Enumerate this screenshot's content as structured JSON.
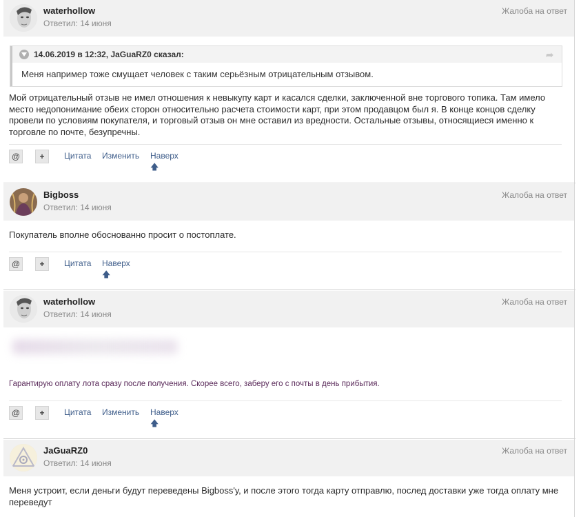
{
  "posts": [
    {
      "author": "waterhollow",
      "answered": "Ответил: 14 июня",
      "report": "Жалоба на ответ",
      "avatar": "face-avatar",
      "quote": {
        "header": "14.06.2019 в 12:32, JaGuaRZ0 сказал:",
        "text": "Меня например тоже смущает человек с таким серьёзным отрицательным отзывом."
      },
      "content": "Мой отрицательный отзыв не имел отношения к невыкупу карт и касался сделки, заключенной вне торгового топика. Там имело место недопонимание обеих сторон относительно расчета стоимости карт, при этом продавцом был я. В конце концов сделку провели по условиям покупателя, и торговый отзыв он мне оставил из вредности. Остальные отзывы, относящиеся именно к торговле по почте, безупречны.",
      "actions": {
        "mention": "@",
        "plus": "+",
        "quote": "Цитата",
        "edit": "Изменить",
        "up": "Наверх"
      }
    },
    {
      "author": "Bigboss",
      "answered": "Ответил: 14 июня",
      "report": "Жалоба на ответ",
      "avatar": "portrait-avatar",
      "content": "Покупатель вполне обоснованно просит о постоплате.",
      "actions": {
        "mention": "@",
        "plus": "+",
        "quote": "Цитата",
        "up": "Наверх"
      }
    },
    {
      "author": "waterhollow",
      "answered": "Ответил: 14 июня",
      "report": "Жалоба на ответ",
      "avatar": "face-avatar",
      "content": "Гарантирую оплату лота сразу после получения. Скорее всего, заберу его с почты в день прибытия.",
      "actions": {
        "mention": "@",
        "plus": "+",
        "quote": "Цитата",
        "edit": "Изменить",
        "up": "Наверх"
      }
    },
    {
      "author": "JaGuaRZ0",
      "answered": "Ответил: 14 июня",
      "report": "Жалоба на ответ",
      "avatar": "triangle-logo-avatar",
      "content": "Меня устроит, если деньги будут переведены Bigboss'у, и после этого тогда карту отправлю, послед доставки уже тогда оплату мне переведут"
    }
  ],
  "colors": {
    "link": "#3e5d8a",
    "header_bg": "#f1f1f1",
    "purple_text": "#5a2a5a"
  }
}
